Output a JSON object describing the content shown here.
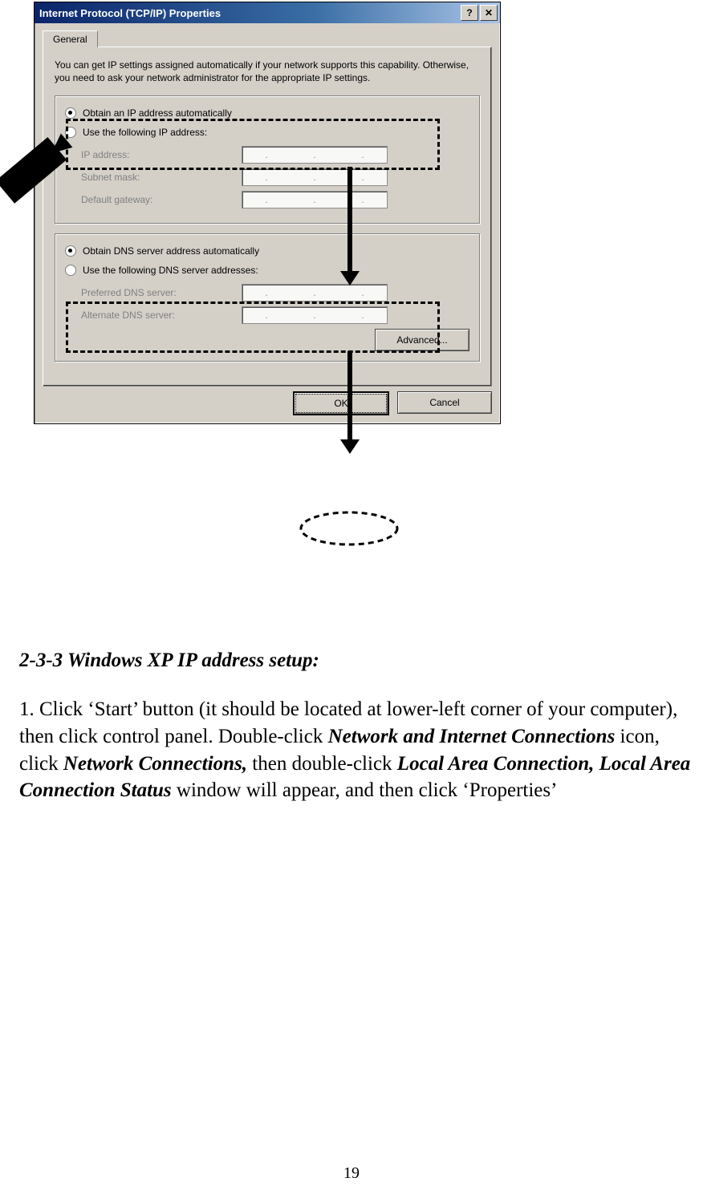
{
  "dialog": {
    "title": "Internet Protocol (TCP/IP) Properties",
    "help_glyph": "?",
    "close_glyph": "✕",
    "tab_label": "General",
    "info": "You can get IP settings assigned automatically if your network supports this capability. Otherwise, you need to ask your network administrator for the appropriate IP settings.",
    "ip_group": {
      "radio_auto": "Obtain an IP address automatically",
      "radio_manual": "Use the following IP address:",
      "ip_label": "IP address:",
      "subnet_label": "Subnet mask:",
      "gateway_label": "Default gateway:"
    },
    "dns_group": {
      "radio_auto": "Obtain DNS server address automatically",
      "radio_manual": "Use the following DNS server addresses:",
      "preferred_label": "Preferred DNS server:",
      "alternate_label": "Alternate DNS server:"
    },
    "advanced_label": "Advanced...",
    "ok_label": "OK",
    "cancel_label": "Cancel"
  },
  "doc": {
    "heading": "2-3-3 Windows XP IP address setup:",
    "p_1": "1. Click ‘Start’ button (it should be located at lower-left corner of your computer), then click control panel. Double-click ",
    "p_2": "Network and Internet Connections",
    "p_3": " icon, click ",
    "p_4": "Network Connections,",
    "p_5": " then double-click ",
    "p_6": "Local Area Connection, Local Area Connection Status",
    "p_7": " window will appear, and then click ‘Properties’"
  },
  "page_number": "19"
}
